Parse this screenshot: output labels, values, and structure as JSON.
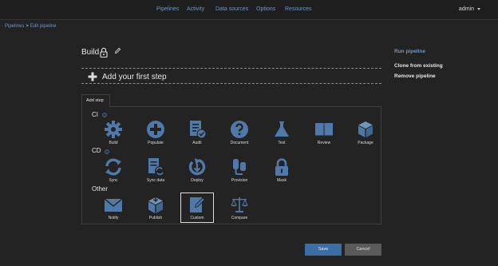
{
  "nav": {
    "links": [
      "Pipelines",
      "Activity",
      "Data sources",
      "Options",
      "Resources"
    ],
    "user": "admin"
  },
  "breadcrumb": {
    "root": "Pipelines",
    "sep": ">",
    "current": "Edit pipeline"
  },
  "pipeline": {
    "title": "Build"
  },
  "first_step": {
    "label": "Add your first step"
  },
  "add_step": {
    "tab_label": "Add step",
    "sections": [
      {
        "name": "CI",
        "steps": [
          "Build",
          "Populate",
          "Audit",
          "Document",
          "Test",
          "Review",
          "Package"
        ]
      },
      {
        "name": "CD",
        "steps": [
          "Sync",
          "Sync data",
          "Deploy",
          "Provision",
          "Mask"
        ]
      },
      {
        "name": "Other",
        "steps": [
          "Notify",
          "Publish",
          "Custom",
          "Compare"
        ]
      }
    ],
    "selected_step": "Custom"
  },
  "side_actions": {
    "run": "Run pipeline",
    "clone": "Clone from existing",
    "remove": "Remove pipeline"
  },
  "buttons": {
    "save": "Save",
    "cancel": "Cancel"
  },
  "colors": {
    "accent": "#6f97c8",
    "icon": "#4f79a8",
    "background": "#232323",
    "save": "#3b6ea4",
    "cancel": "#5a5a5a"
  }
}
